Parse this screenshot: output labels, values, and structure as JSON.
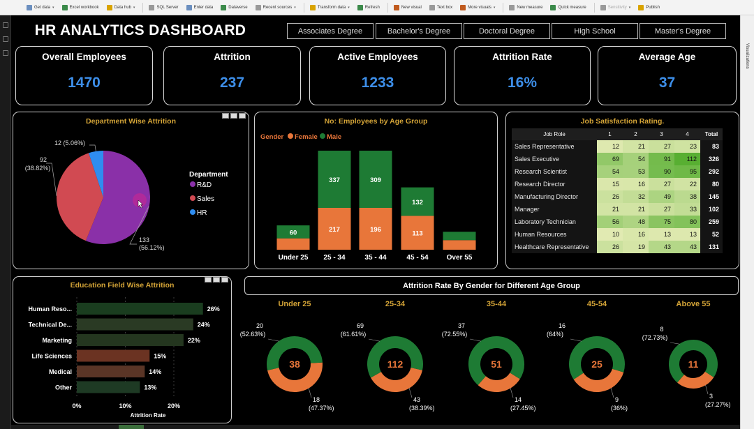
{
  "ribbon": {
    "items": [
      {
        "label": "Get data",
        "dropdown": true,
        "icon": "database-icon"
      },
      {
        "label": "Excel workbook",
        "dropdown": false,
        "icon": "excel-icon"
      },
      {
        "label": "Data hub",
        "dropdown": true,
        "icon": "data-hub-icon"
      },
      {
        "label": "SQL Server",
        "dropdown": false,
        "icon": "sql-server-icon"
      },
      {
        "label": "Enter data",
        "dropdown": false,
        "icon": "table-icon"
      },
      {
        "label": "Dataverse",
        "dropdown": false,
        "icon": "dataverse-icon"
      },
      {
        "label": "Recent sources",
        "dropdown": true,
        "icon": "recent-icon"
      },
      {
        "label": "Transform data",
        "dropdown": true,
        "icon": "transform-icon"
      },
      {
        "label": "Refresh",
        "dropdown": false,
        "icon": "refresh-icon"
      },
      {
        "label": "New visual",
        "dropdown": false,
        "icon": "chart-icon"
      },
      {
        "label": "Text box",
        "dropdown": false,
        "icon": "textbox-icon"
      },
      {
        "label": "More visuals",
        "dropdown": true,
        "icon": "visuals-icon"
      },
      {
        "label": "New measure",
        "dropdown": false,
        "icon": "calculator-icon"
      },
      {
        "label": "Quick measure",
        "dropdown": false,
        "icon": "quick-measure-icon"
      },
      {
        "label": "Sensitivity",
        "dropdown": true,
        "icon": "shield-icon",
        "disabled": true
      },
      {
        "label": "Publish",
        "dropdown": false,
        "icon": "publish-icon"
      }
    ]
  },
  "right_pane_label": "Visualizations",
  "title": "HR ANALYTICS DASHBOARD",
  "slicers": [
    "Associates Degree",
    "Bachelor's Degree",
    "Doctoral Degree",
    "High School",
    "Master's Degree"
  ],
  "kpis": [
    {
      "label": "Overall Employees",
      "value": "1470"
    },
    {
      "label": "Attrition",
      "value": "237"
    },
    {
      "label": "Active Employees",
      "value": "1233"
    },
    {
      "label": "Attrition Rate",
      "value": "16%"
    },
    {
      "label": "Average Age",
      "value": "37"
    }
  ],
  "colors": {
    "accent_blue": "#3d8ee8",
    "title_gold": "#d4a437",
    "rd_purple": "#8a30a8",
    "sales_red": "#d14a52",
    "hr_blue": "#2f8df0",
    "female_orange": "#e8763a",
    "male_green": "#1e7b34"
  },
  "chart_data": [
    {
      "type": "pie",
      "title": "Department Wise Attrition",
      "legend_title": "Department",
      "legend_position": "right",
      "slices": [
        {
          "name": "R&D",
          "value": 133,
          "label": "133",
          "pct_label": "(56.12%)",
          "color": "#8a30a8"
        },
        {
          "name": "Sales",
          "value": 92,
          "label": "92",
          "pct_label": "(38.82%)",
          "color": "#d14a52"
        },
        {
          "name": "HR",
          "value": 12,
          "label": "12 (5.06%)",
          "pct_label": "",
          "color": "#2f8df0"
        }
      ]
    },
    {
      "type": "bar",
      "stacked": true,
      "title": "No: Employees by Age Group",
      "legend_title": "Gender",
      "legend_position": "top-left",
      "categories": [
        "Under 25",
        "25 - 34",
        "35 - 44",
        "45 - 54",
        "Over 55"
      ],
      "series": [
        {
          "name": "Female",
          "color": "#e8763a",
          "values": [
            38,
            217,
            196,
            113,
            32
          ],
          "labels": [
            "",
            "217",
            "196",
            "113",
            ""
          ]
        },
        {
          "name": "Male",
          "color": "#1e7b34",
          "values": [
            60,
            337,
            309,
            132,
            37
          ],
          "labels": [
            "60",
            "337",
            "309",
            "132",
            ""
          ]
        }
      ],
      "ylim": [
        0,
        580
      ]
    },
    {
      "type": "table",
      "title": "Job Satisfaction Rating.",
      "columns": [
        "Job Role",
        "1",
        "2",
        "3",
        "4",
        "Total"
      ],
      "rows": [
        {
          "role": "Sales Representative",
          "vals": [
            12,
            21,
            27,
            23
          ],
          "total": 83
        },
        {
          "role": "Sales Executive",
          "vals": [
            69,
            54,
            91,
            112
          ],
          "total": 326
        },
        {
          "role": "Research Scientist",
          "vals": [
            54,
            53,
            90,
            95
          ],
          "total": 292
        },
        {
          "role": "Research Director",
          "vals": [
            15,
            16,
            27,
            22
          ],
          "total": 80
        },
        {
          "role": "Manufacturing Director",
          "vals": [
            26,
            32,
            49,
            38
          ],
          "total": 145
        },
        {
          "role": "Manager",
          "vals": [
            21,
            21,
            27,
            33
          ],
          "total": 102
        },
        {
          "role": "Laboratory Technician",
          "vals": [
            56,
            48,
            75,
            80
          ],
          "total": 259
        },
        {
          "role": "Human Resources",
          "vals": [
            10,
            16,
            13,
            13
          ],
          "total": 52
        },
        {
          "role": "Healthcare Representative",
          "vals": [
            26,
            19,
            43,
            43
          ],
          "total": 131
        }
      ]
    },
    {
      "type": "bar",
      "orientation": "horizontal",
      "title": "Education Field Wise Attrition",
      "xlabel": "Attrition Rate",
      "categories": [
        "Human Reso...",
        "Technical De...",
        "Marketing",
        "Life Sciences",
        "Medical",
        "Other"
      ],
      "values": [
        26,
        24,
        22,
        15,
        14,
        13
      ],
      "value_labels": [
        "26%",
        "24%",
        "22%",
        "15%",
        "14%",
        "13%"
      ],
      "bar_colors": [
        "#1a3d1f",
        "#2a3a24",
        "#24361f",
        "#6b3322",
        "#5a3526",
        "#1e3a24"
      ],
      "xticks": [
        "0%",
        "10%",
        "20%"
      ],
      "xlim": [
        0,
        30
      ]
    },
    {
      "type": "pie",
      "variant": "donut-group",
      "title": "Attrition Rate By Gender for Different Age Group",
      "groups": [
        {
          "name": "Under 25",
          "total": "38",
          "male": 20,
          "male_label": "20",
          "male_pct": "(52.63%)",
          "female": 18,
          "female_label": "18",
          "female_pct": "(47.37%)"
        },
        {
          "name": "25-34",
          "total": "112",
          "male": 69,
          "male_label": "69",
          "male_pct": "(61.61%)",
          "female": 43,
          "female_label": "43",
          "female_pct": "(38.39%)"
        },
        {
          "name": "35-44",
          "total": "51",
          "male": 37,
          "male_label": "37",
          "male_pct": "(72.55%)",
          "female": 14,
          "female_label": "14",
          "female_pct": "(27.45%)"
        },
        {
          "name": "45-54",
          "total": "25",
          "male": 16,
          "male_label": "16",
          "male_pct": "(64%)",
          "female": 9,
          "female_label": "9",
          "female_pct": "(36%)"
        },
        {
          "name": "Above 55",
          "total": "11",
          "male": 8,
          "male_label": "8",
          "male_pct": "(72.73%)",
          "female": 3,
          "female_label": "3",
          "female_pct": "(27.27%)"
        }
      ]
    }
  ]
}
